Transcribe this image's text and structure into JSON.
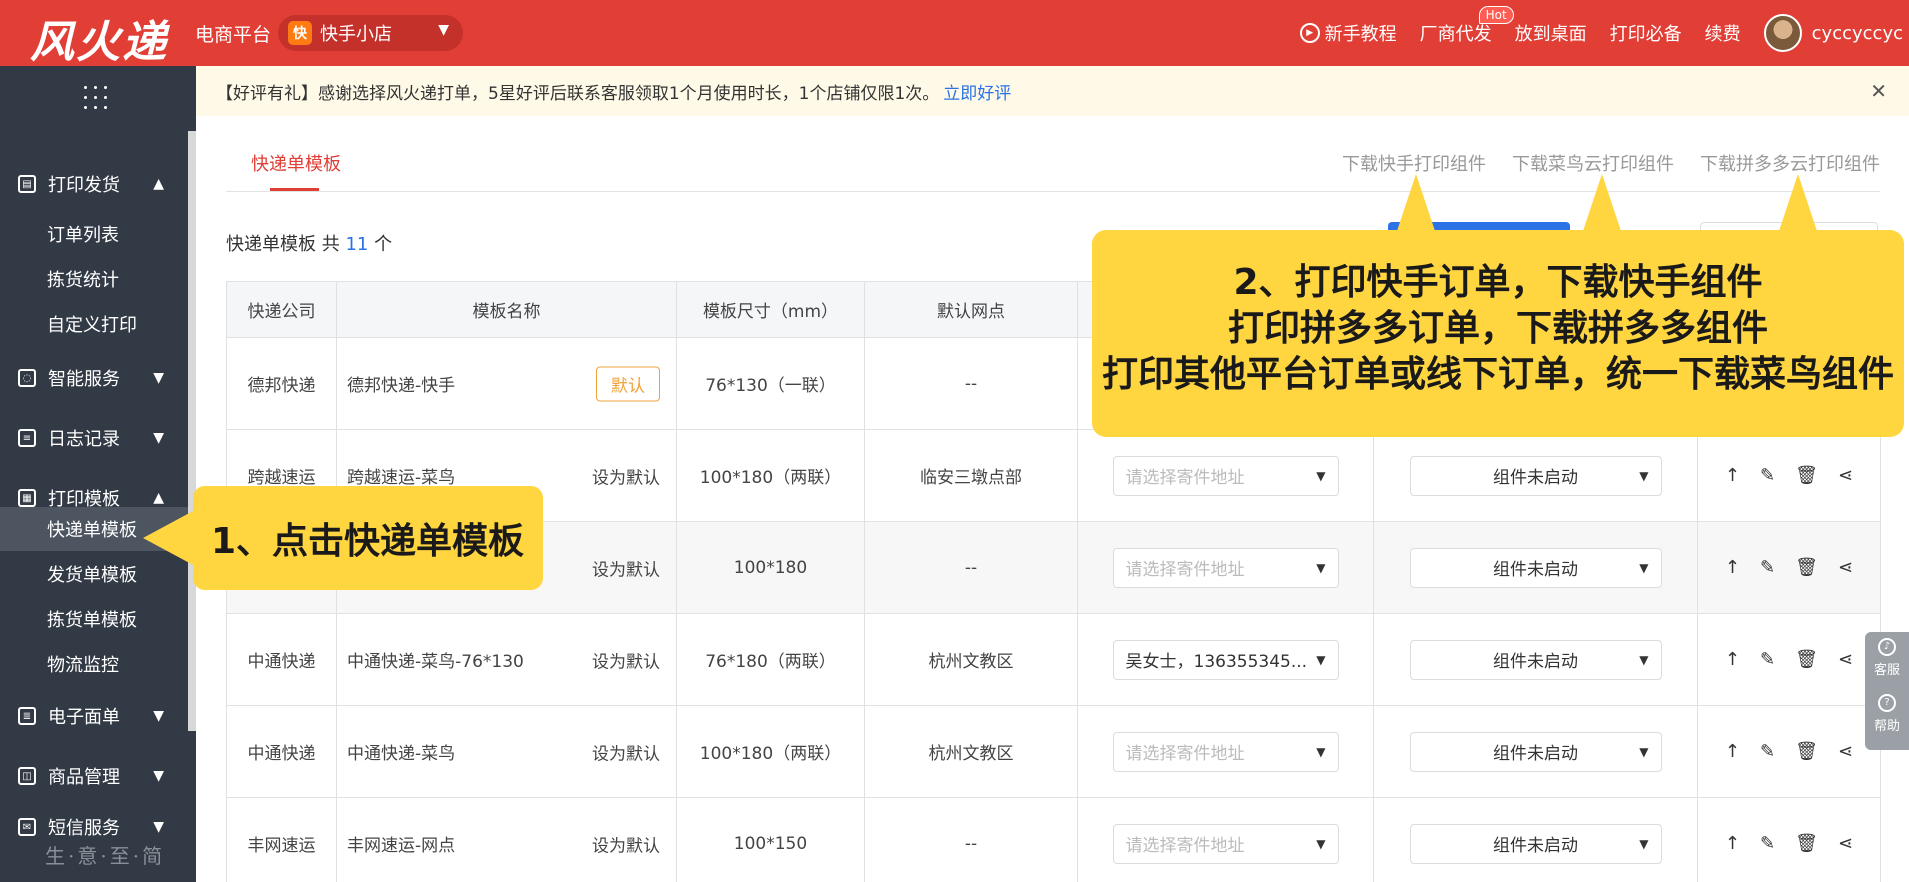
{
  "header": {
    "logo": "风火递",
    "platform_label": "电商平台",
    "shop_icon": "快",
    "shop_name": "快手小店",
    "nav": [
      "新手教程",
      "厂商代发",
      "放到桌面",
      "打印必备",
      "续费"
    ],
    "hot_badge": "Hot",
    "username": "cyccyccyc"
  },
  "sidebar": {
    "groups": [
      {
        "label": "打印发货",
        "icon": "printer-icon",
        "expanded": true
      },
      {
        "label": "智能服务",
        "icon": "bulb-icon",
        "expanded": false
      },
      {
        "label": "日志记录",
        "icon": "doc-icon",
        "expanded": false
      },
      {
        "label": "打印模板",
        "icon": "template-icon",
        "expanded": true
      },
      {
        "label": "电子面单",
        "icon": "sheet-icon",
        "expanded": false
      },
      {
        "label": "商品管理",
        "icon": "bag-icon",
        "expanded": false
      },
      {
        "label": "短信服务",
        "icon": "mail-icon",
        "expanded": false
      }
    ],
    "print_items": [
      "订单列表",
      "拣货统计",
      "自定义打印"
    ],
    "template_items": [
      "快递单模板",
      "发货单模板",
      "拣货单模板",
      "物流监控"
    ],
    "active_item": "快递单模板",
    "watermark": "生·意·至·简"
  },
  "notice": {
    "text": "【好评有礼】感谢选择风火递打单，5星好评后联系客服领取1个月使用时长，1个店铺仅限1次。",
    "link": "立即好评"
  },
  "tabs": {
    "active": "快递单模板",
    "downloads": [
      "下载快手打印组件",
      "下载菜鸟云打印组件",
      "下载拼多多云打印组件"
    ]
  },
  "count": {
    "prefix": "快递单模板 共 ",
    "value": "11",
    "suffix": " 个"
  },
  "table": {
    "headers": [
      "快递公司",
      "模板名称",
      "模板尺寸（mm）",
      "默认网点",
      "",
      "",
      ""
    ],
    "rows": [
      {
        "company": "德邦快递",
        "name": "德邦快递-快手",
        "action": "默认",
        "is_default": true,
        "size": "76*130（一联）",
        "branch": "--",
        "address": "",
        "plugin": ""
      },
      {
        "company": "跨越速运",
        "name": "跨越速运-菜鸟",
        "action": "设为默认",
        "is_default": false,
        "size": "100*180（两联）",
        "branch": "临安三墩点部",
        "address": "请选择寄件地址",
        "plugin": "组件未启动"
      },
      {
        "company": "",
        "name": "",
        "action": "设为默认",
        "is_default": false,
        "size": "100*180",
        "branch": "--",
        "address": "请选择寄件地址",
        "plugin": "组件未启动"
      },
      {
        "company": "中通快递",
        "name": "中通快递-菜鸟-76*130",
        "action": "设为默认",
        "is_default": false,
        "size": "76*180（两联）",
        "branch": "杭州文教区",
        "address": "吴女士，136355345...",
        "address_filled": true,
        "plugin": "组件未启动"
      },
      {
        "company": "中通快递",
        "name": "中通快递-菜鸟",
        "action": "设为默认",
        "is_default": false,
        "size": "100*180（两联）",
        "branch": "杭州文教区",
        "address": "请选择寄件地址",
        "plugin": "组件未启动"
      },
      {
        "company": "丰网速运",
        "name": "丰网速运-网点",
        "action": "设为默认",
        "is_default": false,
        "size": "100*150",
        "branch": "--",
        "address": "请选择寄件地址",
        "plugin": "组件未启动"
      }
    ],
    "ops_icons": [
      "arrow-up-icon",
      "edit-icon",
      "trash-icon",
      "share-icon"
    ]
  },
  "callouts": {
    "step1": "1、点击快递单模板",
    "step2_lines": [
      "2、打印快手订单，下载快手组件",
      "打印拼多多订单，下载拼多多组件",
      "打印其他平台订单或线下订单，统一下载菜鸟组件"
    ]
  },
  "float": {
    "service": "客服",
    "help": "帮助"
  },
  "colors": {
    "brand_red": "#e13e36",
    "sidebar_bg": "#323a45",
    "callout_yellow": "#ffd540",
    "link_blue": "#2a72e6",
    "default_orange": "#f0a33a"
  }
}
